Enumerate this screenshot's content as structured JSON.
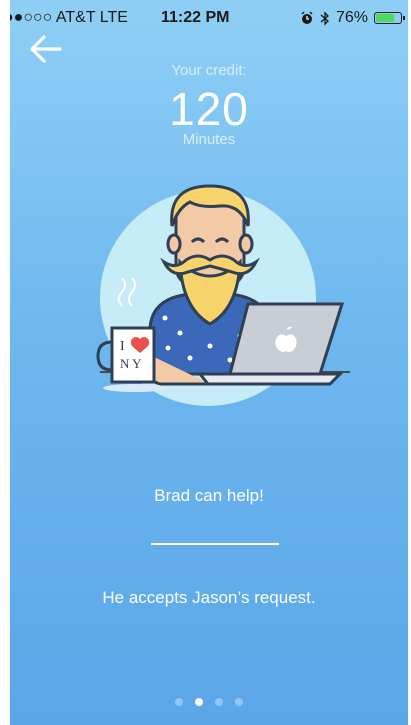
{
  "status_bar": {
    "carrier": "●●○○○ AT&T  LTE",
    "time": "11:22 PM",
    "battery_percent": "76%",
    "battery_level": 0.76,
    "icons": [
      "alarm-icon",
      "bluetooth-icon",
      "battery-icon"
    ]
  },
  "nav": {
    "back_icon": "arrow-left-icon"
  },
  "credit": {
    "label": "Your credit:",
    "value": "120",
    "unit": "Minutes"
  },
  "illustration": {
    "mug_text_line1": "I",
    "mug_text_line2": "N Y",
    "icons": [
      "heart-icon",
      "apple-logo-icon"
    ]
  },
  "message": {
    "headline": "Brad can help!",
    "subline": "He accepts Jason’s request."
  },
  "pager": {
    "total": 4,
    "active_index": 1
  },
  "colors": {
    "background_top": "#8fcff5",
    "background_bottom": "#5aa6e7",
    "text": "#ffffff",
    "battery_green": "#4cd964"
  }
}
